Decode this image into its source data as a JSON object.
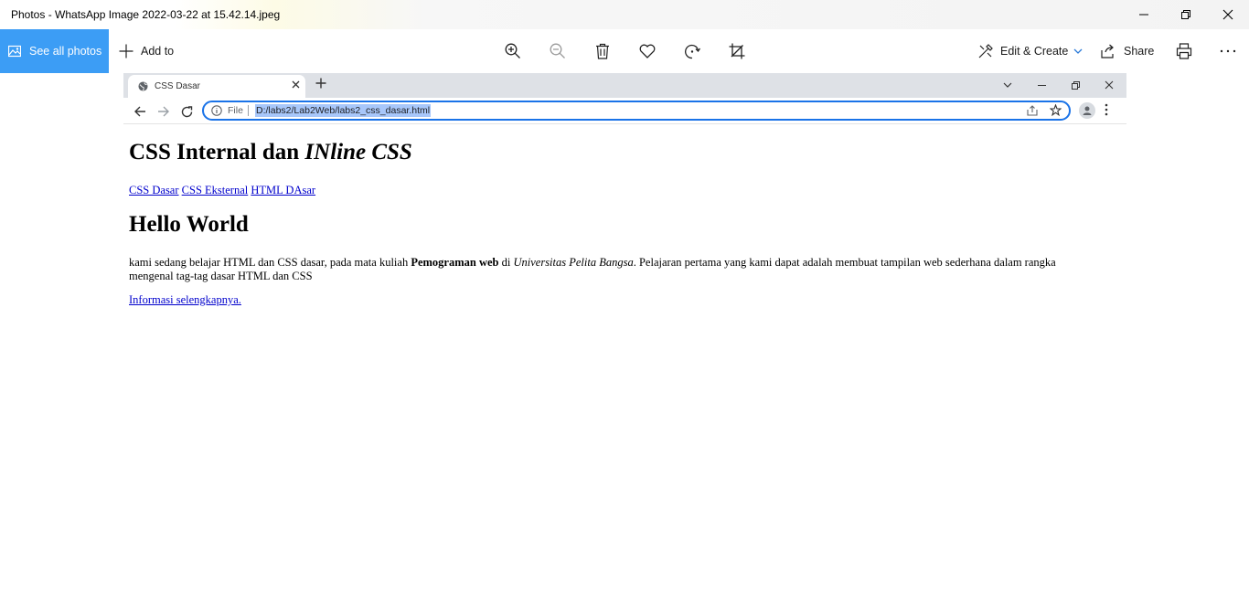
{
  "window": {
    "title": "Photos - WhatsApp Image 2022-03-22 at 15.42.14.jpeg",
    "controls": [
      "minimize",
      "restore",
      "close"
    ]
  },
  "toolbar": {
    "see_all": "See all photos",
    "add_to": "Add to",
    "tools": [
      "zoom-in-icon",
      "zoom-out-icon",
      "trash-icon",
      "heart-icon",
      "rotate-icon",
      "crop-icon"
    ],
    "edit_create": "Edit & Create",
    "share": "Share",
    "print": "print-icon",
    "more": "more-icon",
    "accent": "#3c9df5"
  },
  "browser": {
    "tab_title": "CSS Dasar",
    "omnibox": {
      "scheme_label": "File",
      "url": "D:/labs2/Lab2Web/labs2_css_dasar.html"
    }
  },
  "page": {
    "heading_plain": "CSS Internal dan ",
    "heading_italic": "INline CSS",
    "links": [
      "CSS Dasar",
      "CSS Eksternal",
      "HTML DAsar"
    ],
    "subheading": "Hello World",
    "para": {
      "part1": "kami sedang belajar HTML dan CSS dasar, pada mata kuliah ",
      "bold": "Pemograman web",
      "part2": " di ",
      "italic": "Universitas Pelita Bangsa",
      "part3": ". Pelajaran pertama yang kami dapat adalah membuat tampilan web sederhana dalam rangka mengenal tag-tag dasar HTML dan CSS"
    },
    "more_link": "Informasi selengkapnya."
  }
}
